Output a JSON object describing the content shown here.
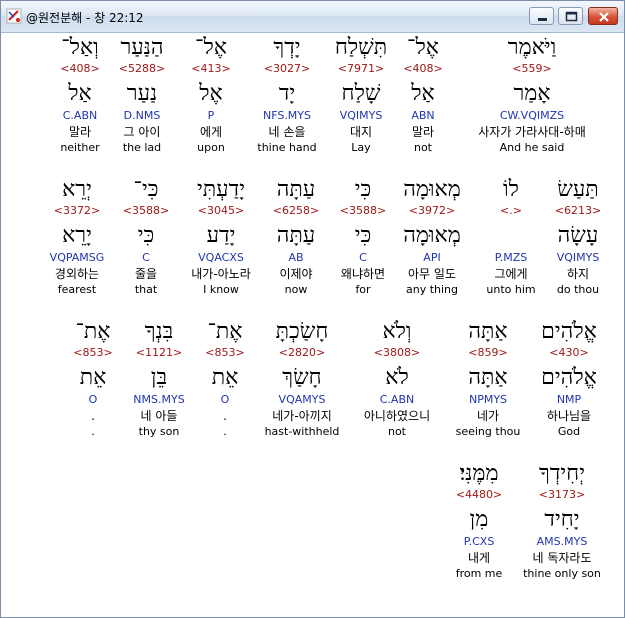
{
  "window": {
    "title": "@원전분해 - 창 22:12"
  },
  "rows": [
    [
      {
        "heb": "וַיֹּאמֶר",
        "strong": "<559>",
        "lemma": "אָמַר",
        "morph": "CW.VQIMZS",
        "kor": "사자가 가라사대-하매",
        "eng": "And he said",
        "highlight": true
      },
      {
        "heb": "אֶל־",
        "strong": "<408>",
        "lemma": "אַל",
        "morph": "ABN",
        "kor": "말라",
        "eng": "not"
      },
      {
        "heb": "תִּשְׁלַח",
        "strong": "<7971>",
        "lemma": "שָׁלַח",
        "morph": "VQIMYS",
        "kor": "대지",
        "eng": "Lay"
      },
      {
        "heb": "יָדְךָ",
        "strong": "<3027>",
        "lemma": "יָד",
        "morph": "NFS.MYS",
        "kor": "네 손을",
        "eng": "thine hand"
      },
      {
        "heb": "אֶל־",
        "strong": "<413>",
        "lemma": "אֶל",
        "morph": "P",
        "kor": "에게",
        "eng": "upon"
      },
      {
        "heb": "הַנַּעַר",
        "strong": "<5288>",
        "lemma": "נַעַר",
        "morph": "D.NMS",
        "kor": "그 아이",
        "eng": "the lad"
      },
      {
        "heb": "וְאַל־",
        "strong": "<408>",
        "lemma": "אַל",
        "morph": "C.ABN",
        "kor": "말라",
        "eng": "neither"
      }
    ],
    [
      {
        "heb": "תַּעַשׂ",
        "strong": "<6213>",
        "lemma": "עָשָׂה",
        "morph": "VQIMYS",
        "kor": "하지",
        "eng": "do thou"
      },
      {
        "heb": "לוֹ",
        "strong": "<.>",
        "lemma": "",
        "morph": "P.MZS",
        "kor": "그에게",
        "eng": "unto him"
      },
      {
        "heb": "מְאוּמָה",
        "strong": "<3972>",
        "lemma": "מְאוּמָה",
        "morph": "API",
        "kor": "아무 일도",
        "eng": "any thing"
      },
      {
        "heb": "כִּי",
        "strong": "<3588>",
        "lemma": "כִּי",
        "morph": "C",
        "kor": "왜냐하면",
        "eng": "for"
      },
      {
        "heb": "עַתָּה",
        "strong": "<6258>",
        "lemma": "עַתָּה",
        "morph": "AB",
        "kor": "이제야",
        "eng": "now"
      },
      {
        "heb": "יָדַעְתִּי",
        "strong": "<3045>",
        "lemma": "יָדַע",
        "morph": "VQACXS",
        "kor": "내가-아노라",
        "eng": "I know"
      },
      {
        "heb": "כִּי־",
        "strong": "<3588>",
        "lemma": "כִּי",
        "morph": "C",
        "kor": "줄을",
        "eng": "that"
      },
      {
        "heb": "יְרֵא",
        "strong": "<3372>",
        "lemma": "יָרֵא",
        "morph": "VQPAMSG",
        "kor": "경외하는",
        "eng": "fearest"
      }
    ],
    [
      {
        "heb": "אֱלֹהִים",
        "strong": "<430>",
        "lemma": "אֱלֹהִים",
        "morph": "NMP",
        "kor": "하나님을",
        "eng": "God"
      },
      {
        "heb": "אַתָּה",
        "strong": "<859>",
        "lemma": "אַתָּה",
        "morph": "NPMYS",
        "kor": "네가",
        "eng": "seeing thou"
      },
      {
        "heb": "וְלֹא",
        "strong": "<3808>",
        "lemma": "לֹא",
        "morph": "C.ABN",
        "kor": "아니하였으니",
        "eng": "not"
      },
      {
        "heb": "חָשַׂכְתָּ",
        "strong": "<2820>",
        "lemma": "חָשַׂךְ",
        "morph": "VQAMYS",
        "kor": "네가-아끼지",
        "eng": "hast-withheld"
      },
      {
        "heb": "אֶת־",
        "strong": "<853>",
        "lemma": "אֵת",
        "morph": "O",
        "kor": ".",
        "eng": "."
      },
      {
        "heb": "בִּנְךָ",
        "strong": "<1121>",
        "lemma": "בֵּן",
        "morph": "NMS.MYS",
        "kor": "네 아들",
        "eng": "thy son"
      },
      {
        "heb": "אֶת־",
        "strong": "<853>",
        "lemma": "אֵת",
        "morph": "O",
        "kor": ".",
        "eng": "."
      }
    ],
    [
      {
        "heb": "יְחִידְךָ",
        "strong": "<3173>",
        "lemma": "יָחִיד",
        "morph": "AMS.MYS",
        "kor": "네 독자라도",
        "eng": "thine only son"
      },
      {
        "heb": "מִמֶּנִּי׃",
        "strong": "<4480>",
        "lemma": "מִן",
        "morph": "P.CXS",
        "kor": "내게",
        "eng": "from me"
      }
    ]
  ]
}
